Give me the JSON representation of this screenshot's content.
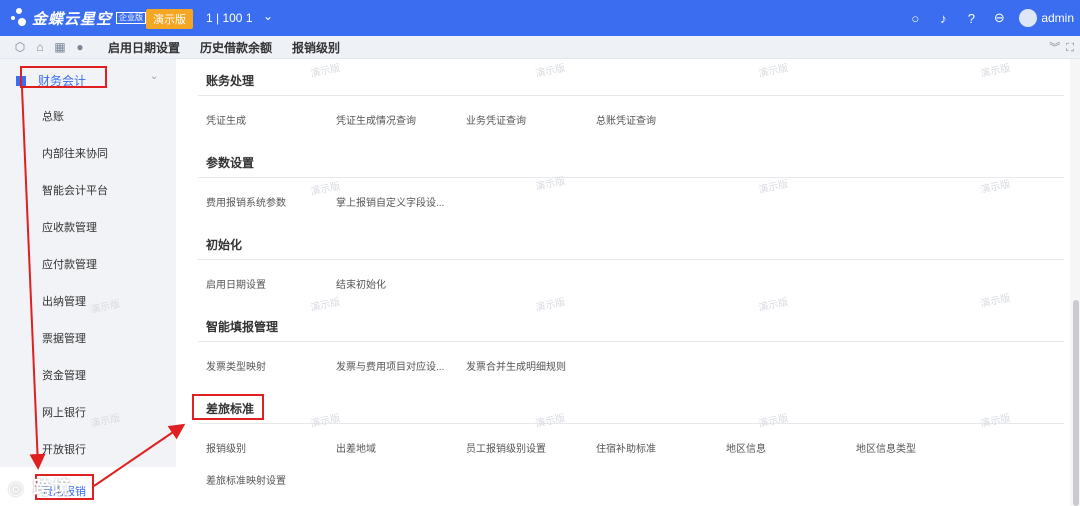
{
  "topbar": {
    "brand": "金蝶云星空",
    "brand_badge": "企业版",
    "demo_badge": "演示版",
    "org": "1 | 100 1",
    "user": "admin"
  },
  "tabs": [
    "启用日期设置",
    "历史借款余额",
    "报销级别"
  ],
  "sidebar": {
    "header": "财务会计",
    "items": [
      "总账",
      "内部往来协同",
      "智能会计平台",
      "应收款管理",
      "应付款管理",
      "出纳管理",
      "票据管理",
      "资金管理",
      "网上银行",
      "开放银行"
    ],
    "active": "费用报销"
  },
  "sections": [
    {
      "title": "账务处理",
      "links": [
        "凭证生成",
        "凭证生成情况查询",
        "业务凭证查询",
        "总账凭证查询"
      ]
    },
    {
      "title": "参数设置",
      "links": [
        "费用报销系统参数",
        "掌上报销自定义字段设..."
      ]
    },
    {
      "title": "初始化",
      "links": [
        "启用日期设置",
        "结束初始化"
      ]
    },
    {
      "title": "智能填报管理",
      "links": [
        "发票类型映射",
        "发票与费用项目对应设...",
        "发票合并生成明细规则"
      ]
    },
    {
      "title": "差旅标准",
      "links": [
        "报销级别",
        "出差地域",
        "员工报销级别设置",
        "住宿补助标准",
        "地区信息",
        "地区信息类型",
        "差旅标准映射设置"
      ]
    }
  ],
  "watermark": "演示版",
  "overlay_watermark": "跨境",
  "colors": {
    "primary": "#3a6df0",
    "demo": "#f5a623",
    "annotation": "#e02020"
  }
}
